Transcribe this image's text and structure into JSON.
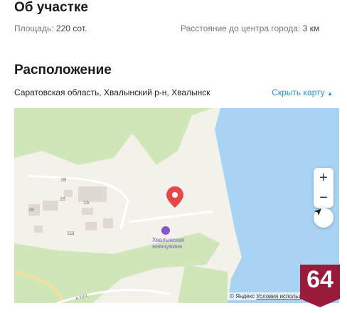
{
  "about": {
    "title": "Об участке",
    "area_label": "Площадь:",
    "area_value": "220 сот.",
    "distance_label": "Расстояние до центра города:",
    "distance_value": "3 км"
  },
  "location": {
    "title": "Расположение",
    "address": "Саратовская область, Хвалынский р-н, Хвалынск",
    "hide_map": "Скрыть карту"
  },
  "map": {
    "poi_label_line1": "Хвалынская",
    "poi_label_line2": "жемчужина",
    "zoom_in": "+",
    "zoom_out": "−",
    "copyright": "© Яндекс",
    "terms": "Условия использова",
    "building_labels": [
      "1Б",
      "1В",
      "1А",
      "1Ш",
      "1Е"
    ],
    "street_label": "я тул.",
    "colors": {
      "water": "#a9d3f2",
      "green": "#cfe6b8",
      "pin": "#e6474b",
      "poi": "#7e5bc8"
    }
  },
  "badge": {
    "text": "64",
    "color": "#9a1a3c"
  }
}
